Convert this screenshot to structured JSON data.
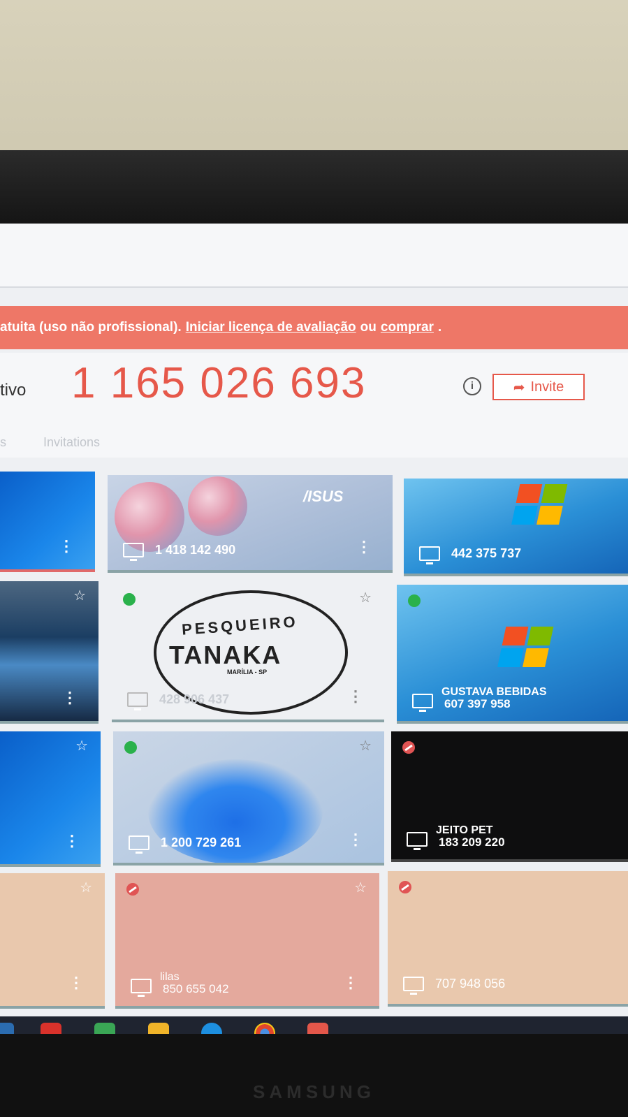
{
  "banner": {
    "prefix": "atuita (uso não profissional).",
    "trial_link": "Iniciar licença de avaliação",
    "or_text": "ou",
    "buy_link": "comprar",
    "suffix": "."
  },
  "device": {
    "label": "tivo",
    "id": "1 165 026 693",
    "info_icon": "info-icon",
    "invite_label": "Invite"
  },
  "tabs": {
    "partial": "s",
    "invitations": "Invitations"
  },
  "devices": [
    {
      "id": "",
      "name": "",
      "status": "none"
    },
    {
      "id": "1 418 142 490",
      "name": "",
      "status": "none"
    },
    {
      "id": "442 375 737",
      "name": "",
      "status": "none"
    },
    {
      "id": "",
      "name": "",
      "status": "none"
    },
    {
      "id": "428 906 437",
      "name": "",
      "status": "online"
    },
    {
      "id": "607 397 958",
      "name": "GUSTAVA BEBIDAS",
      "status": "online"
    },
    {
      "id": "",
      "name": "",
      "status": "none"
    },
    {
      "id": "1 200 729 261",
      "name": "",
      "status": "online"
    },
    {
      "id": "183 209 220",
      "name": "JEITO PET",
      "status": "blocked"
    },
    {
      "id": "",
      "name": "",
      "status": "none"
    },
    {
      "id": "850 655 042",
      "name": "lilas",
      "status": "blocked"
    },
    {
      "id": "707 948 056",
      "name": "",
      "status": "blocked"
    }
  ],
  "wallpaper_text": {
    "asus": "/ISUS",
    "logo_top": "PESQUEIRO",
    "logo_main": "TANAKA",
    "logo_sub": "MARÍLIA - SP"
  },
  "monitor_brand": "SAMSUNG",
  "colors": {
    "accent": "#e6584a",
    "banner_bg": "#ee7767",
    "online": "#2ab14b",
    "blocked": "#e05454"
  }
}
